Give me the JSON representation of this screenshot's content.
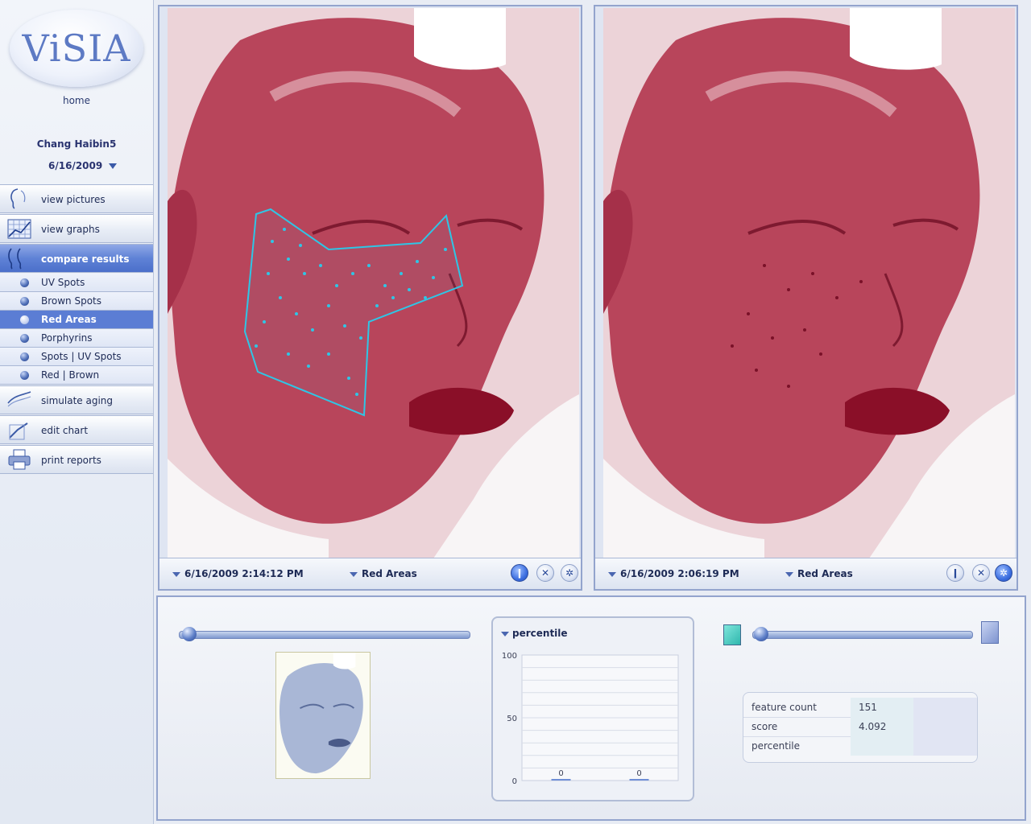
{
  "app": {
    "logo_text": "ViSIA",
    "home_label": "home"
  },
  "patient": {
    "name": "Chang Haibin5",
    "date": "6/16/2009"
  },
  "nav": {
    "view_pictures": "view pictures",
    "view_graphs": "view graphs",
    "compare_results": "compare results",
    "simulate_aging": "simulate aging",
    "edit_chart": "edit chart",
    "print_reports": "print reports"
  },
  "subnav": [
    "UV Spots",
    "Brown Spots",
    "Red Areas",
    "Porphyrins",
    "Spots | UV Spots",
    "Red | Brown"
  ],
  "subnav_active": "Red Areas",
  "left_panel": {
    "datetime": "6/16/2009 2:14:12 PM",
    "mode": "Red Areas"
  },
  "right_panel": {
    "datetime": "6/16/2009 2:06:19 PM",
    "mode": "Red Areas"
  },
  "colors": {
    "accent": "#5b7dd4",
    "photo_red": "#a8243c",
    "detection": "#2ec6e6"
  },
  "chart_data": {
    "type": "bar",
    "title": "percentile",
    "categories": [
      "",
      ""
    ],
    "values": [
      0,
      0
    ],
    "value_labels": [
      "0",
      "0"
    ],
    "ylim": [
      0,
      100
    ],
    "yticks": [
      0,
      50,
      100
    ],
    "grid": true
  },
  "stats": {
    "feature_count_label": "feature count",
    "feature_count_value": "151",
    "score_label": "score",
    "score_value": "4.092",
    "percentile_label": "percentile",
    "percentile_value": ""
  }
}
